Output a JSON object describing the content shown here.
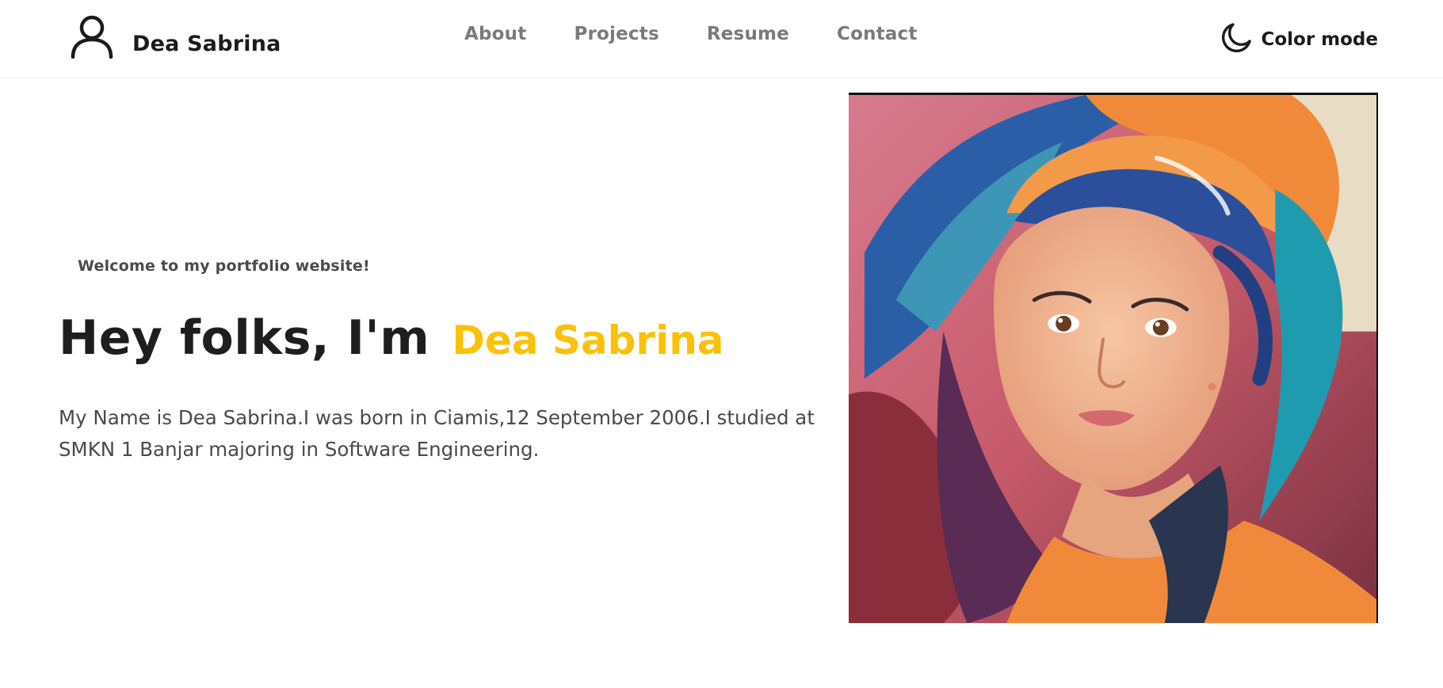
{
  "nav": {
    "brand_icon": "user-icon",
    "brand_name": "Dea Sabrina",
    "links": [
      {
        "label": "About"
      },
      {
        "label": "Projects"
      },
      {
        "label": "Resume"
      },
      {
        "label": "Contact"
      }
    ],
    "color_mode_icon": "moon-icon",
    "color_mode_label": "Color mode"
  },
  "hero": {
    "welcome": "Welcome to my portfolio website!",
    "headline_prefix": "Hey folks, I'm",
    "headline_name": "Dea Sabrina",
    "bio": "My Name is Dea Sabrina.I was born in Ciamis,12 September 2006.I studied at SMKN 1 Banjar majoring in Software Engineering.",
    "accent_color": "#fbc10a"
  }
}
